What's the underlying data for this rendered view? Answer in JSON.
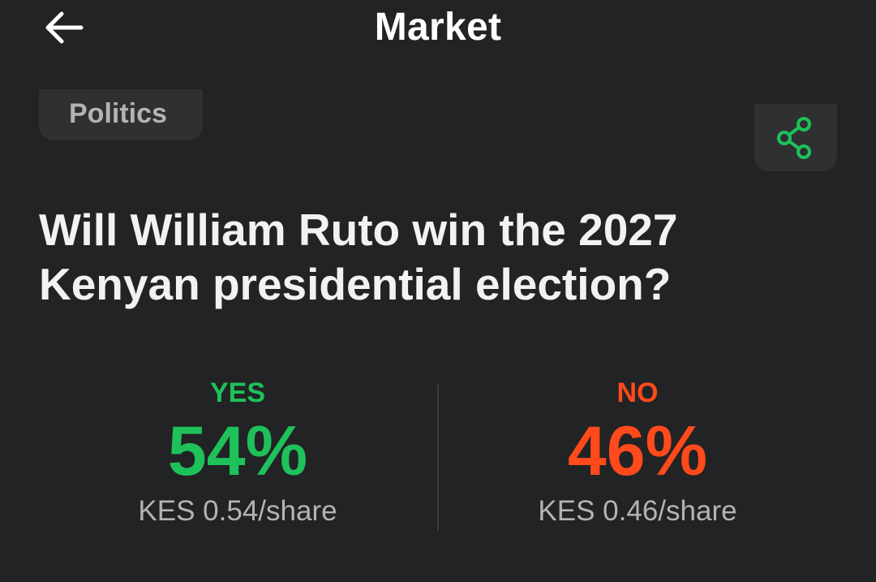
{
  "header": {
    "title": "Market",
    "back_icon": "arrow-left-icon"
  },
  "market": {
    "category": "Politics",
    "share_icon": "share-icon",
    "question": "Will William Ruto win the 2027 Kenyan presidential election?",
    "outcomes": [
      {
        "label": "YES",
        "percent": "54%",
        "price": "KES 0.54/share",
        "color": "#1ec15a"
      },
      {
        "label": "NO",
        "percent": "46%",
        "price": "KES 0.46/share",
        "color": "#ff4a1c"
      }
    ]
  },
  "colors": {
    "background": "#222324",
    "surface": "#2f3032",
    "accent_yes": "#1ec15a",
    "accent_no": "#ff4a1c"
  }
}
